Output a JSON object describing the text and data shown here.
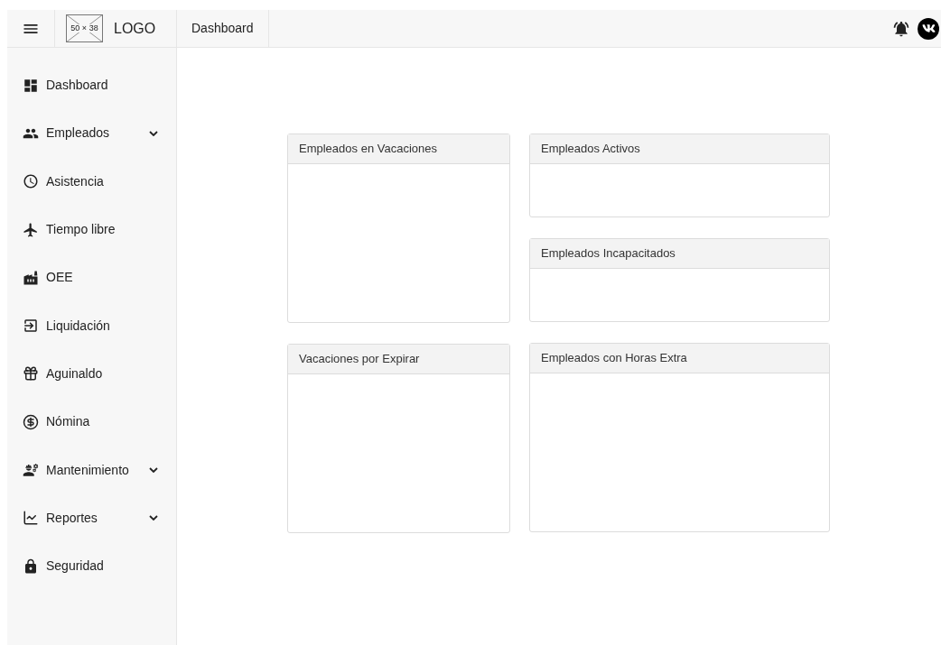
{
  "header": {
    "logo_placeholder": "50 × 38",
    "logo_text": "LOGO",
    "breadcrumb": "Dashboard"
  },
  "sidebar": {
    "items": [
      {
        "label": "Dashboard",
        "has_submenu": false
      },
      {
        "label": "Empleados",
        "has_submenu": true
      },
      {
        "label": "Asistencia",
        "has_submenu": false
      },
      {
        "label": "Tiempo libre",
        "has_submenu": false
      },
      {
        "label": "OEE",
        "has_submenu": false
      },
      {
        "label": "Liquidación",
        "has_submenu": false
      },
      {
        "label": "Aguinaldo",
        "has_submenu": false
      },
      {
        "label": "Nómina",
        "has_submenu": false
      },
      {
        "label": "Mantenimiento",
        "has_submenu": true
      },
      {
        "label": "Reportes",
        "has_submenu": true
      },
      {
        "label": "Seguridad",
        "has_submenu": false
      }
    ]
  },
  "columns": [
    [
      {
        "title": "Empleados en Vacaciones",
        "kind": "tall"
      },
      {
        "title": "Vacaciones por Expirar",
        "kind": "tall"
      }
    ],
    [
      {
        "title": "Empleados Activos",
        "kind": "short"
      },
      {
        "title": "Empleados Incapacitados",
        "kind": "short"
      },
      {
        "title": "Empleados con Horas Extra",
        "kind": "tall"
      }
    ]
  ]
}
